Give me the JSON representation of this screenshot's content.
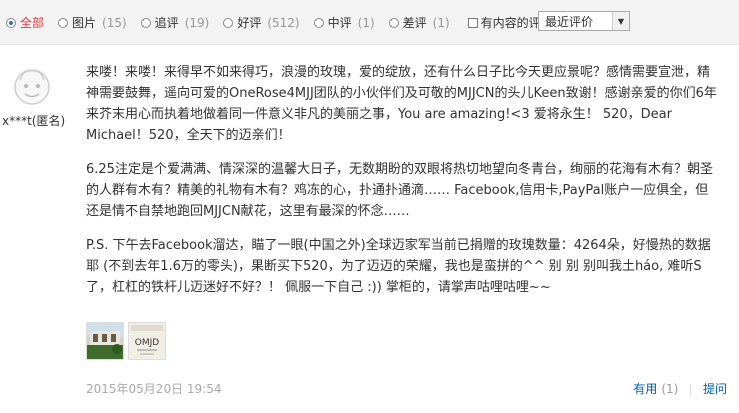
{
  "filters": [
    {
      "label": "全部",
      "count": ""
    },
    {
      "label": "图片",
      "count": "(15)"
    },
    {
      "label": "追评",
      "count": "(19)"
    },
    {
      "label": "好评",
      "count": "(512)"
    },
    {
      "label": "中评",
      "count": "(1)"
    },
    {
      "label": "差评",
      "count": "(1)"
    }
  ],
  "content_filter_label": "有内容的评价",
  "sort": {
    "selected": "最近评价"
  },
  "review": {
    "username": "x***t(匿名)",
    "paragraphs": [
      "来喽！来喽！来得早不如来得巧，浪漫的玫瑰，爱的绽放，还有什么日子比今天更应景呢？感情需要宣泄，精神需要鼓舞，遥向可爱的OneRose4MJJ团队的小伙伴们及可敬的MJJCN的头儿Keen致谢！感谢亲爱的你们6年来芥末用心而执着地做着同一件意义非凡的美丽之事，You are amazing!<3 爱将永生！ 520，Dear Michael！520，全天下的迈亲们！",
      "6.25注定是个爱满满、情深深的温馨大日子，无数期盼的双眼将热切地望向冬青台，绚丽的花海有木有？朝圣的人群有木有？精美的礼物有木有？鸡冻的心，扑通扑通滴…… Facebook,信用卡,PayPal账户一应俱全，但还是情不自禁地跑回MJJCN献花，这里有最深的怀念……",
      "P.S. 下午去Facebook溜达，瞄了一眼(中国之外)全球迈家军当前已捐赠的玫瑰数量：4264朵，好慢热的数据耶 (不到去年1.6万的零头)，果断买下520，为了迈迈的荣耀，我也是蛮拼的^^ 别 别 别叫我土háo, 难听S了，杠杠的铁杆儿迈迷好不好？！ 佩服一下自己 :)) 掌柜的，请掌声咕哩咕哩~~"
    ],
    "thumbnail_texts": [
      "OMJD"
    ],
    "date": "2015年05月20日 19:54",
    "useful_label": "有用",
    "useful_count": "(1)",
    "reply_label": "提问"
  }
}
